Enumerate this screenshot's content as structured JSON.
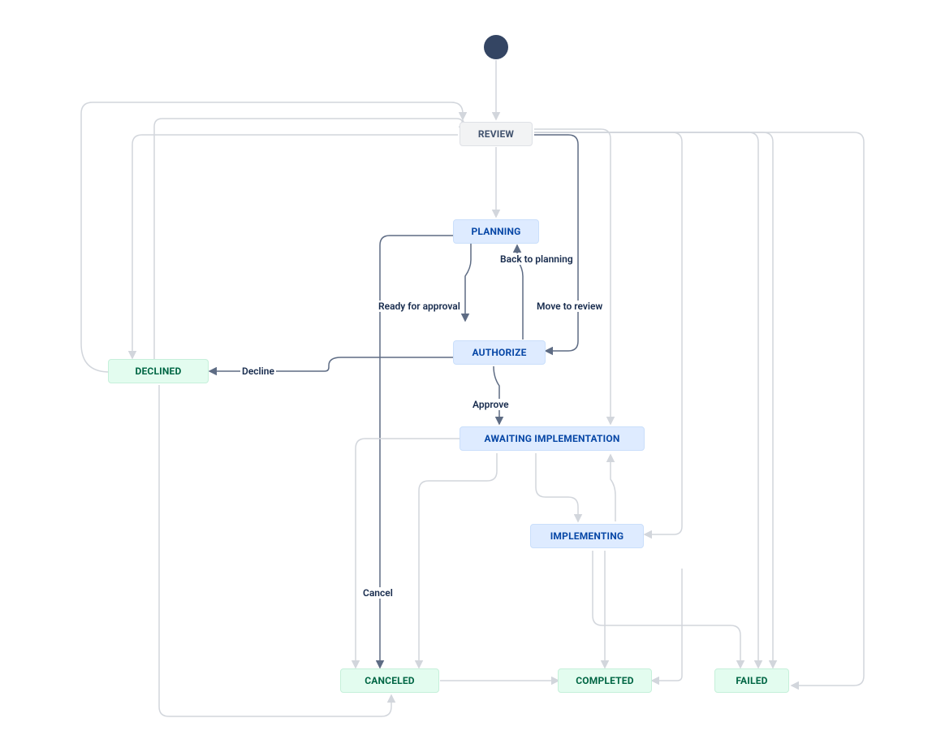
{
  "nodes": {
    "review": "REVIEW",
    "planning": "PLANNING",
    "authorize": "AUTHORIZE",
    "awaiting": "AWAITING IMPLEMENTATION",
    "implementing": "IMPLEMENTING",
    "declined": "DECLINED",
    "canceled": "CANCELED",
    "completed": "COMPLETED",
    "failed": "FAILED"
  },
  "labels": {
    "back_to_planning": "Back to planning",
    "ready_for_approval": "Ready for approval",
    "move_to_review": "Move to review",
    "approve": "Approve",
    "decline": "Decline",
    "cancel": "Cancel"
  }
}
